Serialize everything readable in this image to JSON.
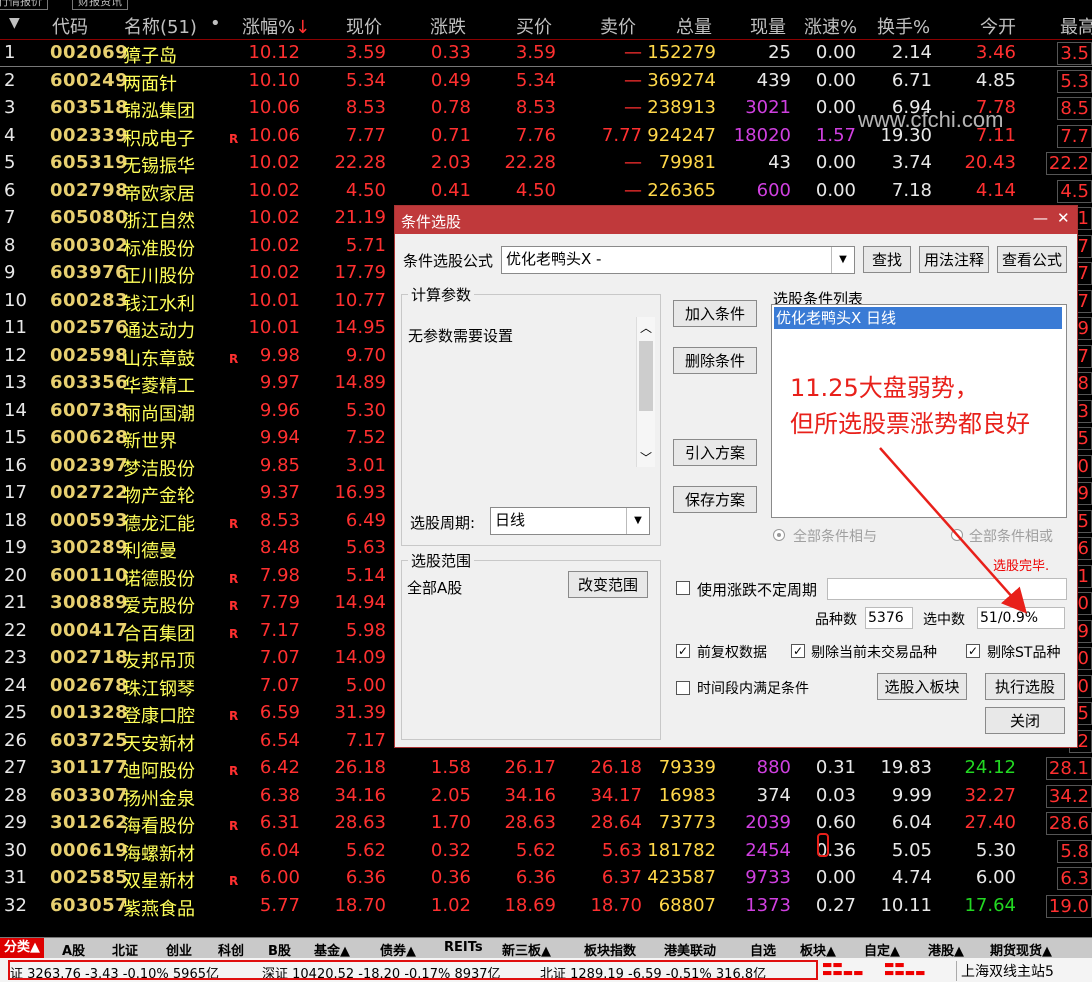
{
  "top_tabs": [
    "行情报价",
    "财报资讯"
  ],
  "header": {
    "sort_indicator": "▼",
    "code": "代码",
    "name": "名称(51)",
    "dot": "•",
    "change_pct": "涨幅%",
    "sort_arrow": "↓",
    "price": "现价",
    "change": "涨跌",
    "bid": "买价",
    "ask": "卖价",
    "volume": "总量",
    "cur_vol": "现量",
    "speed": "涨速%",
    "turnover": "换手%",
    "open": "今开",
    "high": "最高"
  },
  "rows": [
    {
      "i": "1",
      "code": "002069",
      "name": "獐子岛",
      "r": "",
      "pct": "10.12",
      "price": "3.59",
      "chg": "0.33",
      "bid": "3.59",
      "ask": "—",
      "vol": "152279",
      "cv": "25",
      "spd": "0.00",
      "to": "2.14",
      "open": "3.46",
      "high": "3.5"
    },
    {
      "i": "2",
      "code": "600249",
      "name": "两面针",
      "r": "",
      "pct": "10.10",
      "price": "5.34",
      "chg": "0.49",
      "bid": "5.34",
      "ask": "—",
      "vol": "369274",
      "cv": "439",
      "spd": "0.00",
      "to": "6.71",
      "open": "4.85",
      "high": "5.3"
    },
    {
      "i": "3",
      "code": "603518",
      "name": "锦泓集团",
      "r": "",
      "pct": "10.06",
      "price": "8.53",
      "chg": "0.78",
      "bid": "8.53",
      "ask": "—",
      "vol": "238913",
      "cv": "3021",
      "spd": "0.00",
      "to": "6.94",
      "open": "7.78",
      "high": "8.5"
    },
    {
      "i": "4",
      "code": "002339",
      "name": "积成电子",
      "r": "R",
      "pct": "10.06",
      "price": "7.77",
      "chg": "0.71",
      "bid": "7.76",
      "ask": "7.77",
      "vol": "924247",
      "cv": "18020",
      "spd": "1.57",
      "to": "19.30",
      "open": "7.11",
      "high": "7.7"
    },
    {
      "i": "5",
      "code": "605319",
      "name": "无锡振华",
      "r": "",
      "pct": "10.02",
      "price": "22.28",
      "chg": "2.03",
      "bid": "22.28",
      "ask": "—",
      "vol": "79981",
      "cv": "43",
      "spd": "0.00",
      "to": "3.74",
      "open": "20.43",
      "high": "22.2"
    },
    {
      "i": "6",
      "code": "002798",
      "name": "帝欧家居",
      "r": "",
      "pct": "10.02",
      "price": "4.50",
      "chg": "0.41",
      "bid": "4.50",
      "ask": "—",
      "vol": "226365",
      "cv": "600",
      "spd": "0.00",
      "to": "7.18",
      "open": "4.14",
      "high": "4.5"
    },
    {
      "i": "7",
      "code": "605080",
      "name": "浙江自然",
      "r": "",
      "pct": "10.02",
      "price": "21.19",
      "chg": "",
      "bid": "",
      "ask": "",
      "vol": "",
      "cv": "",
      "spd": "",
      "to": "",
      "open": "",
      "high": ".1"
    },
    {
      "i": "8",
      "code": "600302",
      "name": "标准股份",
      "r": "",
      "pct": "10.02",
      "price": "5.71",
      "chg": "",
      "bid": "",
      "ask": "",
      "vol": "",
      "cv": "",
      "spd": "",
      "to": "",
      "open": "",
      "high": ".7"
    },
    {
      "i": "9",
      "code": "603976",
      "name": "正川股份",
      "r": "",
      "pct": "10.02",
      "price": "17.79",
      "chg": "",
      "bid": "",
      "ask": "",
      "vol": "",
      "cv": "",
      "spd": "",
      "to": "",
      "open": "",
      "high": ".7"
    },
    {
      "i": "10",
      "code": "600283",
      "name": "钱江水利",
      "r": "",
      "pct": "10.01",
      "price": "10.77",
      "chg": "",
      "bid": "",
      "ask": "",
      "vol": "",
      "cv": "",
      "spd": "",
      "to": "",
      "open": "",
      "high": ".7"
    },
    {
      "i": "11",
      "code": "002576",
      "name": "通达动力",
      "r": "",
      "pct": "10.01",
      "price": "14.95",
      "chg": "",
      "bid": "",
      "ask": "",
      "vol": "",
      "cv": "",
      "spd": "",
      "to": "",
      "open": "",
      "high": ".9"
    },
    {
      "i": "12",
      "code": "002598",
      "name": "山东章鼓",
      "r": "R",
      "pct": "9.98",
      "price": "9.70",
      "chg": "",
      "bid": "",
      "ask": "",
      "vol": "",
      "cv": "",
      "spd": "",
      "to": "",
      "open": "",
      "high": ".7"
    },
    {
      "i": "13",
      "code": "603356",
      "name": "华菱精工",
      "r": "",
      "pct": "9.97",
      "price": "14.89",
      "chg": "",
      "bid": "",
      "ask": "",
      "vol": "",
      "cv": "",
      "spd": "",
      "to": "",
      "open": "",
      "high": ".8"
    },
    {
      "i": "14",
      "code": "600738",
      "name": "丽尚国潮",
      "r": "",
      "pct": "9.96",
      "price": "5.30",
      "chg": "",
      "bid": "",
      "ask": "",
      "vol": "",
      "cv": "",
      "spd": "",
      "to": "",
      "open": "",
      "high": ".3"
    },
    {
      "i": "15",
      "code": "600628",
      "name": "新世界",
      "r": "",
      "pct": "9.94",
      "price": "7.52",
      "chg": "",
      "bid": "",
      "ask": "",
      "vol": "",
      "cv": "",
      "spd": "",
      "to": "",
      "open": "",
      "high": ".5"
    },
    {
      "i": "16",
      "code": "002397",
      "name": "梦洁股份",
      "r": "",
      "pct": "9.85",
      "price": "3.01",
      "chg": "",
      "bid": "",
      "ask": "",
      "vol": "",
      "cv": "",
      "spd": "",
      "to": "",
      "open": "",
      "high": ".0"
    },
    {
      "i": "17",
      "code": "002722",
      "name": "物产金轮",
      "r": "",
      "pct": "9.37",
      "price": "16.93",
      "chg": "",
      "bid": "",
      "ask": "",
      "vol": "",
      "cv": "",
      "spd": "",
      "to": "",
      "open": "",
      "high": ".9"
    },
    {
      "i": "18",
      "code": "000593",
      "name": "德龙汇能",
      "r": "R",
      "pct": "8.53",
      "price": "6.49",
      "chg": "",
      "bid": "",
      "ask": "",
      "vol": "",
      "cv": "",
      "spd": "",
      "to": "",
      "open": "",
      "high": ".5"
    },
    {
      "i": "19",
      "code": "300289",
      "name": "利德曼",
      "r": "",
      "pct": "8.48",
      "price": "5.63",
      "chg": "",
      "bid": "",
      "ask": "",
      "vol": "",
      "cv": "",
      "spd": "",
      "to": "",
      "open": "",
      "high": ".6"
    },
    {
      "i": "20",
      "code": "600110",
      "name": "诺德股份",
      "r": "R",
      "pct": "7.98",
      "price": "5.14",
      "chg": "",
      "bid": "",
      "ask": "",
      "vol": "",
      "cv": "",
      "spd": "",
      "to": "",
      "open": "",
      "high": ".1"
    },
    {
      "i": "21",
      "code": "300889",
      "name": "爱克股份",
      "r": "R",
      "pct": "7.79",
      "price": "14.94",
      "chg": "",
      "bid": "",
      "ask": "",
      "vol": "",
      "cv": "",
      "spd": "",
      "to": "",
      "open": "",
      "high": ".0"
    },
    {
      "i": "22",
      "code": "000417",
      "name": "合百集团",
      "r": "R",
      "pct": "7.17",
      "price": "5.98",
      "chg": "",
      "bid": "",
      "ask": "",
      "vol": "",
      "cv": "",
      "spd": "",
      "to": "",
      "open": "",
      "high": ".9"
    },
    {
      "i": "23",
      "code": "002718",
      "name": "友邦吊顶",
      "r": "",
      "pct": "7.07",
      "price": "14.09",
      "chg": "",
      "bid": "",
      "ask": "",
      "vol": "",
      "cv": "",
      "spd": "",
      "to": "",
      "open": "",
      "high": ".0"
    },
    {
      "i": "24",
      "code": "002678",
      "name": "珠江钢琴",
      "r": "",
      "pct": "7.07",
      "price": "5.00",
      "chg": "",
      "bid": "",
      "ask": "",
      "vol": "",
      "cv": "",
      "spd": "",
      "to": "",
      "open": "",
      "high": ".0"
    },
    {
      "i": "25",
      "code": "001328",
      "name": "登康口腔",
      "r": "R",
      "pct": "6.59",
      "price": "31.39",
      "chg": "",
      "bid": "",
      "ask": "",
      "vol": "",
      "cv": "",
      "spd": "",
      "to": "",
      "open": "",
      "high": ".5"
    },
    {
      "i": "26",
      "code": "603725",
      "name": "天安新材",
      "r": "",
      "pct": "6.54",
      "price": "7.17",
      "chg": "",
      "bid": "",
      "ask": "",
      "vol": "",
      "cv": "",
      "spd": "",
      "to": "",
      "open": "",
      "high": ".2"
    },
    {
      "i": "27",
      "code": "301177",
      "name": "迪阿股份",
      "r": "R",
      "pct": "6.42",
      "price": "26.18",
      "chg": "1.58",
      "bid": "26.17",
      "ask": "26.18",
      "vol": "79339",
      "cv": "880",
      "spd": "0.31",
      "to": "19.83",
      "open": "24.12",
      "high": "28.1"
    },
    {
      "i": "28",
      "code": "603307",
      "name": "扬州金泉",
      "r": "",
      "pct": "6.38",
      "price": "34.16",
      "chg": "2.05",
      "bid": "34.16",
      "ask": "34.17",
      "vol": "16983",
      "cv": "374",
      "spd": "0.03",
      "to": "9.99",
      "open": "32.27",
      "high": "34.2"
    },
    {
      "i": "29",
      "code": "301262",
      "name": "海看股份",
      "r": "R",
      "pct": "6.31",
      "price": "28.63",
      "chg": "1.70",
      "bid": "28.63",
      "ask": "28.64",
      "vol": "73773",
      "cv": "2039",
      "spd": "0.60",
      "to": "6.04",
      "open": "27.40",
      "high": "28.6"
    },
    {
      "i": "30",
      "code": "000619",
      "name": "海螺新材",
      "r": "",
      "pct": "6.04",
      "price": "5.62",
      "chg": "0.32",
      "bid": "5.62",
      "ask": "5.63",
      "vol": "181782",
      "cv": "2454",
      "spd": "0.36",
      "to": "5.05",
      "open": "5.30",
      "high": "5.8"
    },
    {
      "i": "31",
      "code": "002585",
      "name": "双星新材",
      "r": "R",
      "pct": "6.00",
      "price": "6.36",
      "chg": "0.36",
      "bid": "6.36",
      "ask": "6.37",
      "vol": "423587",
      "cv": "9733",
      "spd": "0.00",
      "to": "4.74",
      "open": "6.00",
      "high": "6.3"
    },
    {
      "i": "32",
      "code": "603057",
      "name": "紫燕食品",
      "r": "",
      "pct": "5.77",
      "price": "18.70",
      "chg": "1.02",
      "bid": "18.69",
      "ask": "18.70",
      "vol": "68807",
      "cv": "1373",
      "spd": "0.27",
      "to": "10.11",
      "open": "17.64",
      "high": "19.0"
    }
  ],
  "watermark": "www.cfchi.com",
  "dialog": {
    "title": "条件选股",
    "min_btn": "—",
    "close_btn": "✕",
    "formula_label": "条件选股公式",
    "formula_value": "优化老鸭头X  -",
    "find_btn": "查找",
    "usage_btn": "用法注释",
    "view_formula_btn": "查看公式",
    "params_group": "计算参数",
    "params_text": "无参数需要设置",
    "add_cond_btn": "加入条件",
    "del_cond_btn": "删除条件",
    "import_btn": "引入方案",
    "save_btn": "保存方案",
    "cond_list_label": "选股条件列表",
    "cond_list_item": "优化老鸭头X  日线",
    "period_label": "选股周期:",
    "period_value": "日线",
    "and_label": "全部条件相与",
    "or_label": "全部条件相或",
    "done_text": "选股完毕.",
    "range_group": "选股范围",
    "range_value": "全部A股",
    "change_range_btn": "改变范围",
    "use_period_label": "使用涨跌不定周期",
    "count_label": "品种数",
    "count_value": "5376",
    "selected_label": "选中数",
    "selected_value": "51/0.9%",
    "fq_label": "前复权数据",
    "excl_untraded_label": "剔除当前未交易品种",
    "excl_st_label": "剔除ST品种",
    "time_cond_label": "时间段内满足条件",
    "to_block_btn": "选股入板块",
    "run_btn": "执行选股",
    "close_btn2": "关闭",
    "scroll_up": "︿",
    "scroll_down": "﹀"
  },
  "annotation": {
    "line1": "11.25大盘弱势，",
    "line2": "但所选股票涨势都良好"
  },
  "bottom_tabs": [
    "分类▲",
    "A股",
    "北证",
    "创业",
    "科创",
    "B股",
    "基金▲",
    "债券▲",
    "REITs",
    "新三板▲",
    "板块指数",
    "港美联动",
    "自选",
    "板块▲",
    "自定▲",
    "港股▲",
    "期货现货▲"
  ],
  "status": {
    "sh": "证 3263.76   -3.43   -0.10%   5965亿",
    "sz": "深证 10420.52  -18.20   -0.17%   8937亿",
    "bj": "北证 1289.19   -6.59   -0.51%   316.8亿",
    "server": "上海双线主站5"
  },
  "colors": {
    "rise": "#ff3030",
    "fall": "#22d822",
    "dialog_title": "#c0393b",
    "annotation": "#e8201a"
  }
}
